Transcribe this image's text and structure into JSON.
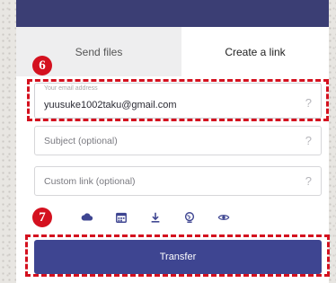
{
  "tabs": {
    "send_files": "Send files",
    "create_link": "Create a link"
  },
  "form": {
    "email_label": "Your email address",
    "email_value": "yuusuke1002taku@gmail.com",
    "subject_placeholder": "Subject (optional)",
    "custom_link_placeholder": "Custom link (optional)",
    "help_glyph": "?"
  },
  "options_icons": [
    "cloud-icon",
    "calendar-icon",
    "download-icon",
    "globe-icon",
    "eye-icon"
  ],
  "transfer_label": "Transfer",
  "annotations": {
    "step6": "6",
    "step7": "7"
  },
  "colors": {
    "header": "#3b3e74",
    "button": "#3e4591",
    "annotation_red": "#d4111f",
    "icon": "#3e4591"
  }
}
